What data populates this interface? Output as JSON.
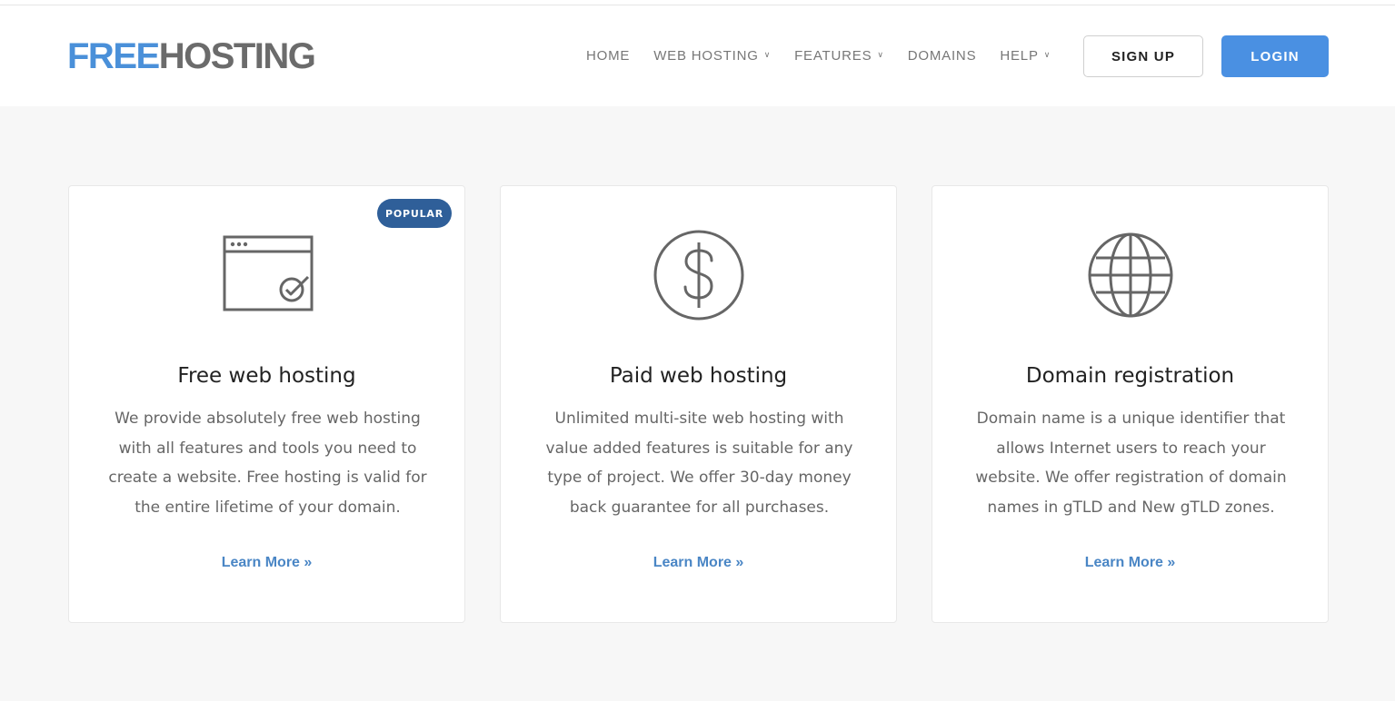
{
  "header": {
    "logo": {
      "part1": "FREE",
      "part2": "HOSTING"
    },
    "nav": [
      {
        "label": "HOME",
        "dropdown": false
      },
      {
        "label": "WEB HOSTING",
        "dropdown": true
      },
      {
        "label": "FEATURES",
        "dropdown": true
      },
      {
        "label": "DOMAINS",
        "dropdown": false
      },
      {
        "label": "HELP",
        "dropdown": true
      }
    ],
    "signup_label": "SIGN UP",
    "login_label": "LOGIN"
  },
  "cards": [
    {
      "badge": "POPULAR",
      "icon": "browser-check-icon",
      "title": "Free web hosting",
      "description": "We provide absolutely free web hosting with all features and tools you need to create a website. Free hosting is valid for the entire lifetime of your domain.",
      "link": "Learn More »"
    },
    {
      "icon": "dollar-icon",
      "title": "Paid web hosting",
      "description": "Unlimited multi-site web hosting with value added features is suitable for any type of project. We offer 30-day money back guarantee for all purchases.",
      "link": "Learn More »"
    },
    {
      "icon": "globe-icon",
      "title": "Domain registration",
      "description": "Domain name is a unique identifier that allows Internet users to reach your website. We offer registration of domain names in gTLD and New gTLD zones.",
      "link": "Learn More »"
    }
  ],
  "colors": {
    "brand_blue": "#4a90d9",
    "brand_gray": "#6b6b6b",
    "badge_blue": "#2f5f99",
    "link_blue": "#4a86c5",
    "icon_gray": "#666666"
  }
}
